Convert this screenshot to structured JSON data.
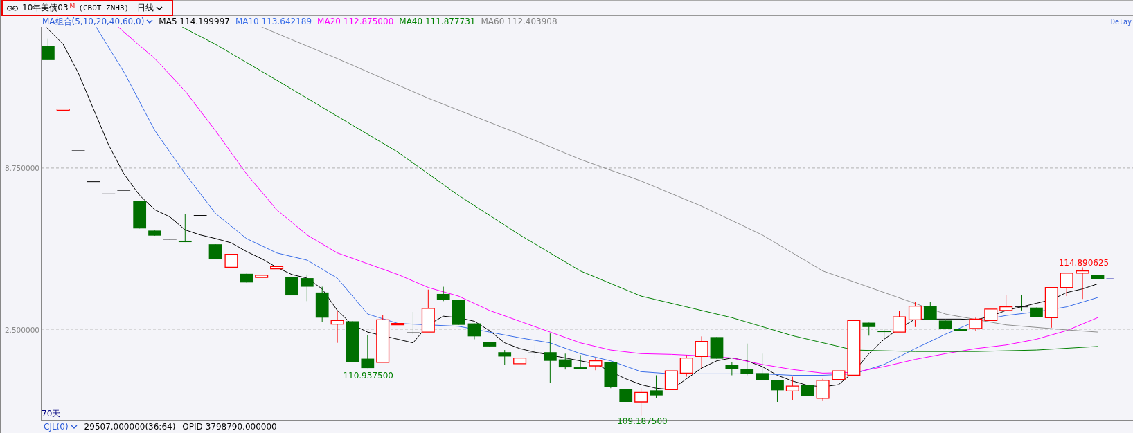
{
  "header": {
    "title": "10年美债03",
    "badge": "M",
    "code": "(CBOT ZNH3)",
    "period": "日线"
  },
  "ma_row": {
    "selector": "MA组合(5,10,20,40,60,0)",
    "values": [
      {
        "label": "MA5 114.199997",
        "color": "#000000"
      },
      {
        "label": "MA10 113.642189",
        "color": "#3a6ee8"
      },
      {
        "label": "MA20 112.875000",
        "color": "#ff00ff"
      },
      {
        "label": "MA40 111.877731",
        "color": "#008000"
      },
      {
        "label": "MA60 112.403908",
        "color": "#808080"
      }
    ],
    "status": "Delay"
  },
  "axis": {
    "yticks": [
      "8.750000",
      "2.500000"
    ]
  },
  "chart": {
    "labels": [
      {
        "kind": "low",
        "text": "110.937500"
      },
      {
        "kind": "low",
        "text": "109.187500"
      },
      {
        "kind": "high",
        "text": "114.890625"
      }
    ],
    "range": "70天"
  },
  "volume_row": {
    "selector": "CJL(0)",
    "values": [
      "29507.000000(36:64)",
      "OPID 3798790.000000"
    ]
  }
}
